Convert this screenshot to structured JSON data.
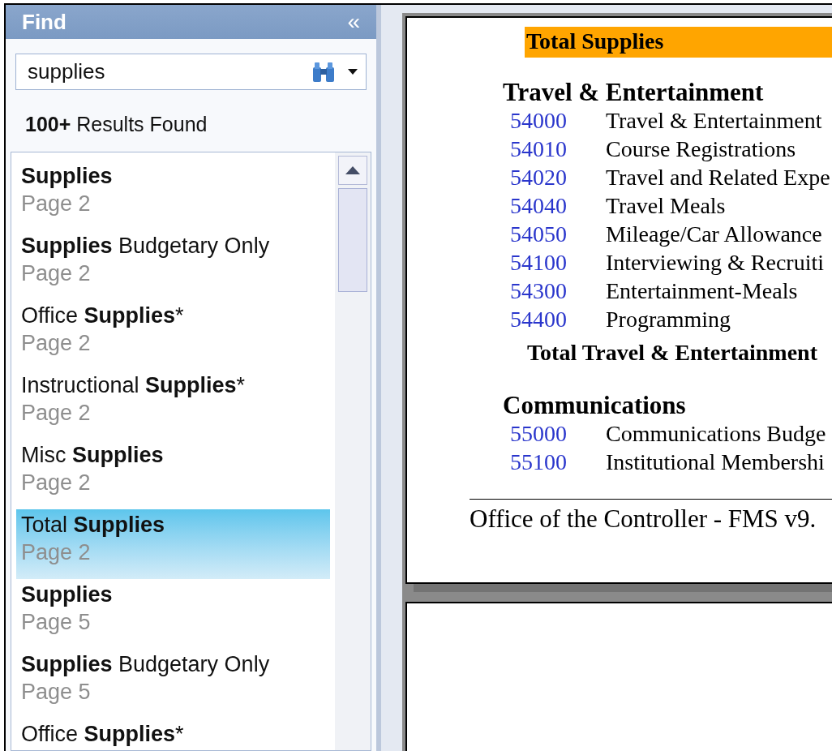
{
  "find_panel": {
    "title": "Find",
    "collapse_glyph": "«",
    "search": {
      "value": "supplies"
    },
    "results_count": "**100+** Results Found",
    "results": [
      {
        "title": "**Supplies**",
        "page": "Page 2",
        "selected": false
      },
      {
        "title": "**Supplies** Budgetary Only",
        "page": "Page 2",
        "selected": false
      },
      {
        "title": "Office **Supplies***",
        "page": "Page 2",
        "selected": false
      },
      {
        "title": "Instructional **Supplies***",
        "page": "Page 2",
        "selected": false
      },
      {
        "title": "Misc **Supplies**",
        "page": "Page 2",
        "selected": false
      },
      {
        "title": "Total **Supplies**",
        "page": "Page 2",
        "selected": true
      },
      {
        "title": "**Supplies**",
        "page": "Page 5",
        "selected": false
      },
      {
        "title": "**Supplies** Budgetary Only",
        "page": "Page 5",
        "selected": false
      },
      {
        "title": "Office **Supplies***",
        "selected": false
      }
    ]
  },
  "document": {
    "highlighted_total": "Total Supplies",
    "sections": [
      {
        "heading": "Travel & Entertainment",
        "accounts": [
          {
            "code": "54000",
            "name": "Travel &  Entertainment"
          },
          {
            "code": "54010",
            "name": "Course Registrations"
          },
          {
            "code": "54020",
            "name": "Travel and Related Expe"
          },
          {
            "code": "54040",
            "name": "Travel Meals"
          },
          {
            "code": "54050",
            "name": "Mileage/Car Allowance"
          },
          {
            "code": "54100",
            "name": "Interviewing & Recruiti"
          },
          {
            "code": "54300",
            "name": "Entertainment-Meals"
          },
          {
            "code": "54400",
            "name": "Programming"
          }
        ],
        "total": "Total Travel & Entertainment"
      },
      {
        "heading": "Communications",
        "accounts": [
          {
            "code": "55000",
            "name": "Communications Budge"
          },
          {
            "code": "55100",
            "name": "Institutional Membershi"
          }
        ]
      }
    ],
    "footer": "Office of the Controller - FMS v9."
  }
}
